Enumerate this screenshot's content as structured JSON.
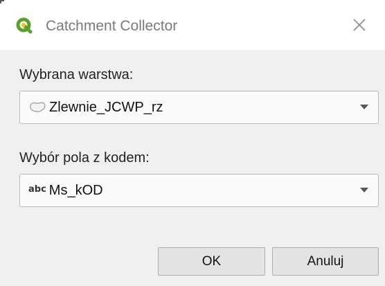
{
  "window": {
    "title": "Catchment Collector",
    "app_icon": "qgis-icon",
    "close_icon": "close-icon"
  },
  "layer_field": {
    "label": "Wybrana warstwa:",
    "selected_value": "Zlewnie_JCWP_rz",
    "icon": "polygon-layer-icon"
  },
  "code_field": {
    "label": "Wybór pola z kodem:",
    "selected_value": "Ms_kOD",
    "icon_text": "abc"
  },
  "buttons": {
    "ok_label": "OK",
    "cancel_label": "Anuluj"
  },
  "colors": {
    "qgis_green": "#5aa02c",
    "qgis_yellow": "#f0c419"
  }
}
